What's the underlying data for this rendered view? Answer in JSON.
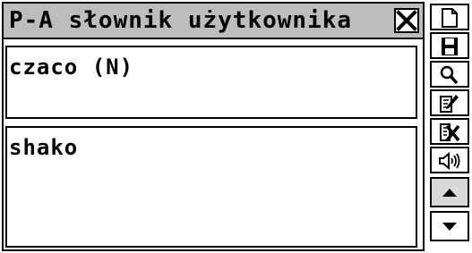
{
  "window": {
    "title": "P-A słownik użytkownika"
  },
  "source_entry": {
    "text": "czaco (N)"
  },
  "target_entry": {
    "text": "shako"
  },
  "toolbar": {
    "icons": [
      "new-icon",
      "save-icon",
      "search-icon",
      "edit-icon",
      "delete-icon",
      "speaker-icon",
      "arrow-up-icon",
      "arrow-down-icon"
    ]
  },
  "colors": {
    "titlebar": "#bdbdbd",
    "border": "#000000",
    "background": "#ffffff"
  }
}
